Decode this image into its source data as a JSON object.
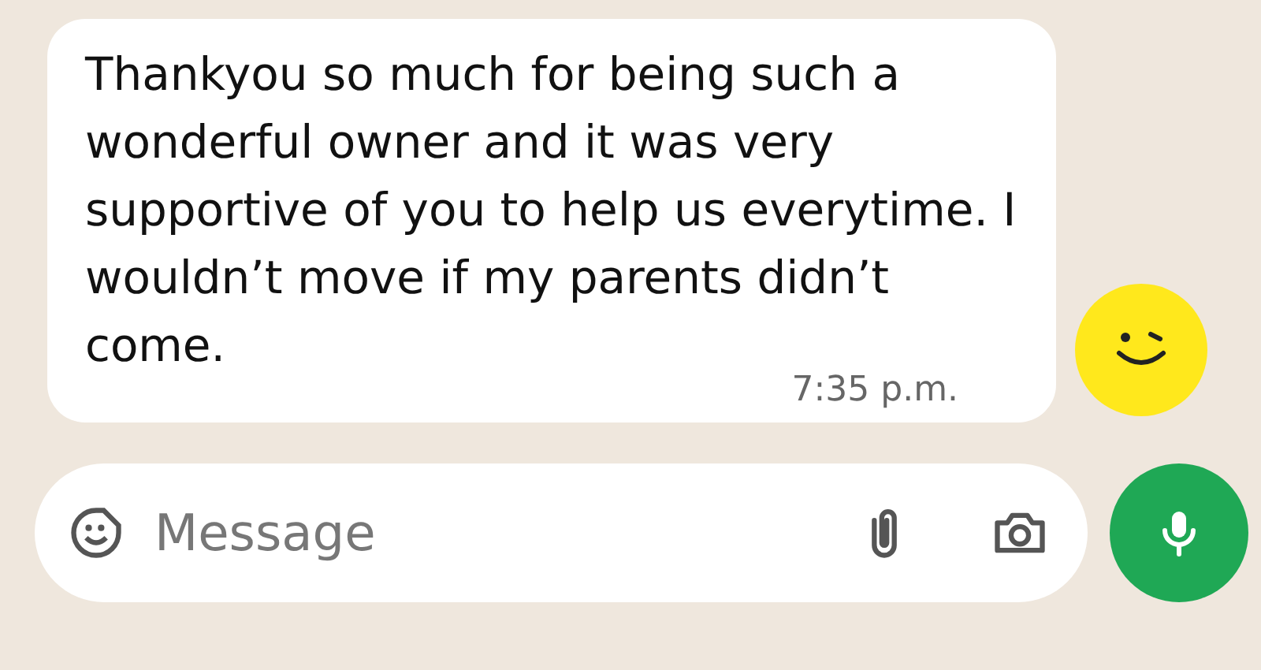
{
  "message": {
    "text": "Thankyou so much for being such a wonderful owner and it was very supportive of you to help us everytime. I wouldn’t move if my parents didn’t come.",
    "time": "7:35 p.m."
  },
  "composer": {
    "placeholder": "Message"
  }
}
